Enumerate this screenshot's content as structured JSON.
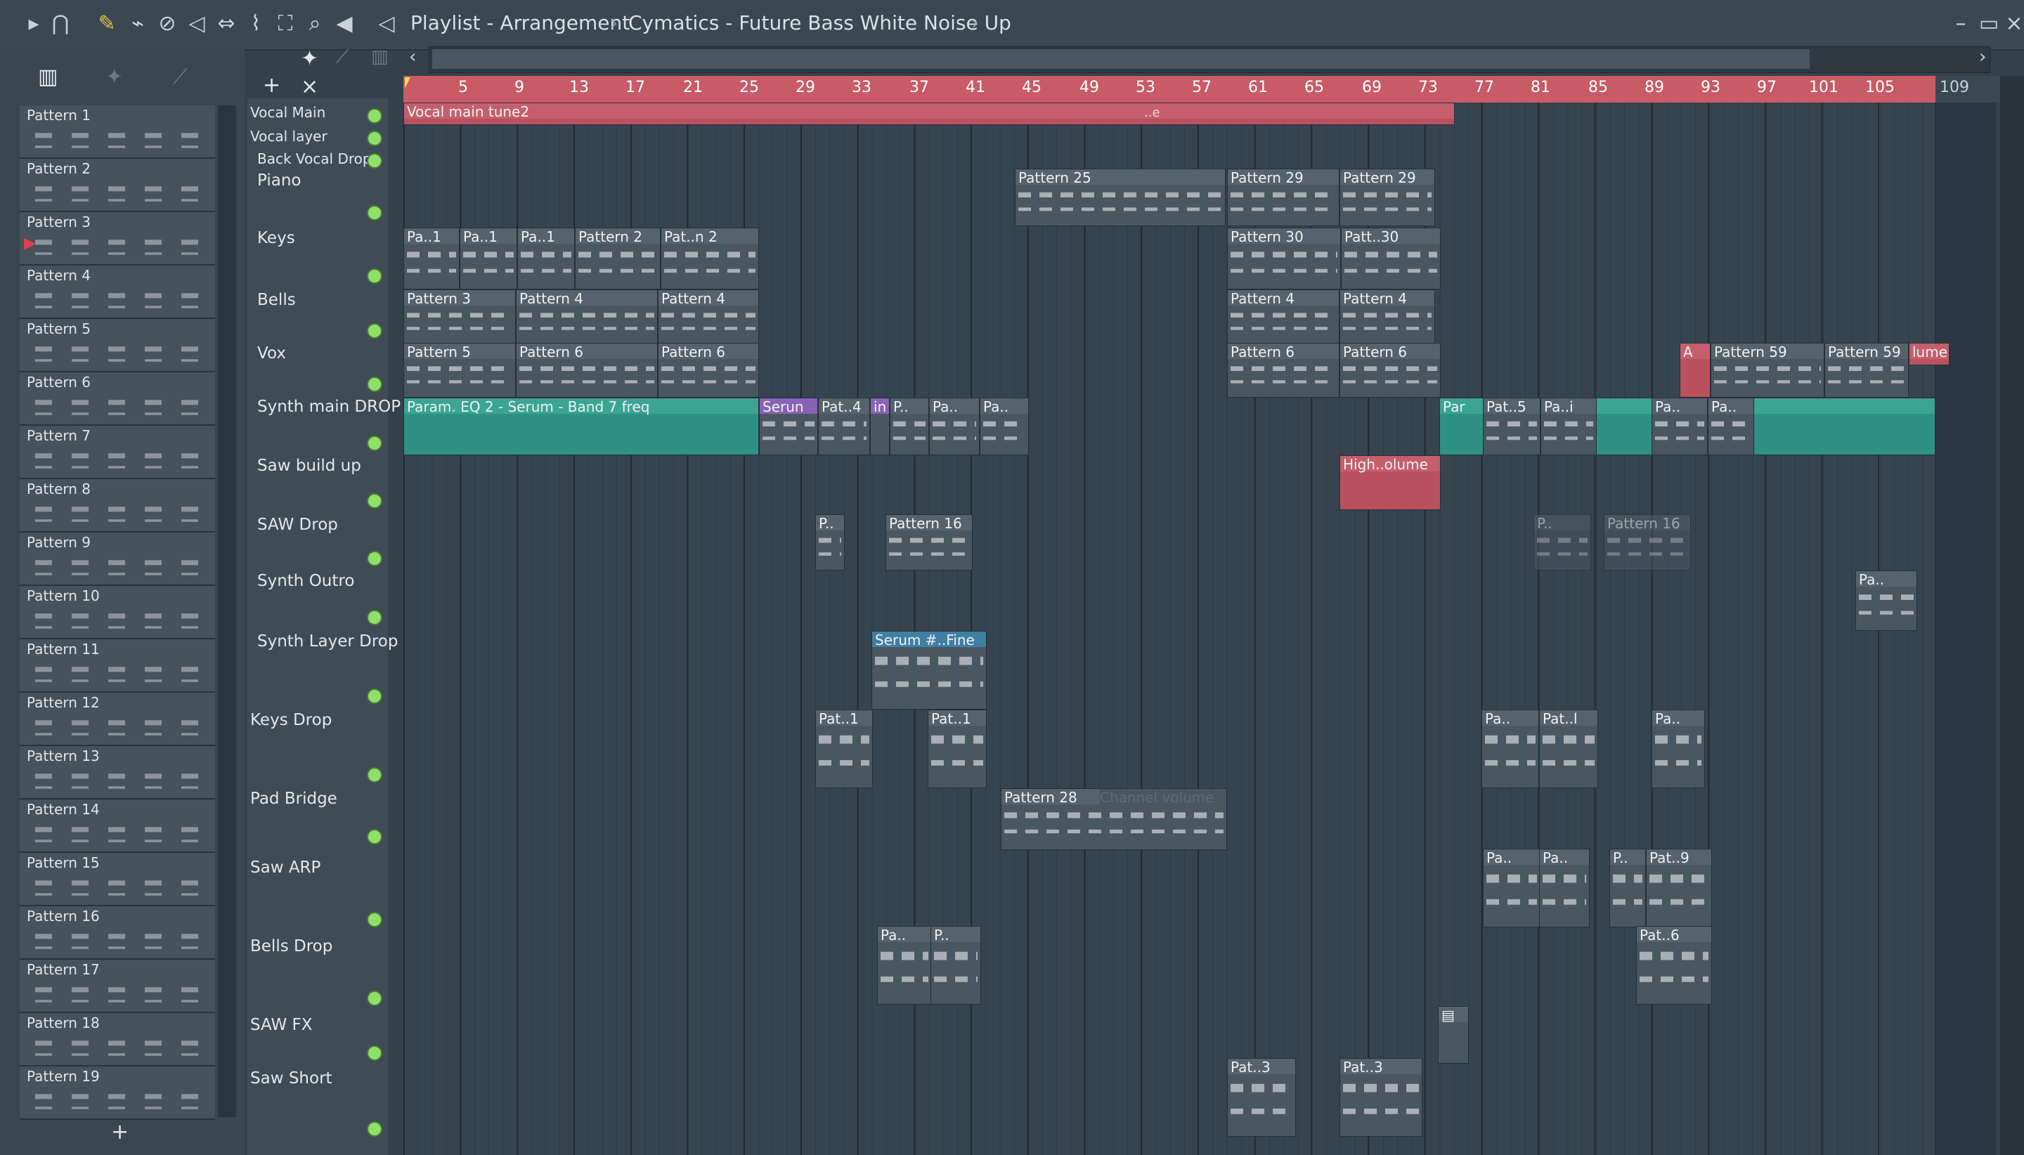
{
  "titlebar": {
    "title": "Playlist - Arrangement",
    "project": "Cymatics - Future Bass White Noise Up"
  },
  "patterns": [
    "Pattern 1",
    "Pattern 2",
    "Pattern 3",
    "Pattern 4",
    "Pattern 5",
    "Pattern 6",
    "Pattern 7",
    "Pattern 8",
    "Pattern 9",
    "Pattern 10",
    "Pattern 11",
    "Pattern 12",
    "Pattern 13",
    "Pattern 14",
    "Pattern 15",
    "Pattern 16",
    "Pattern 17",
    "Pattern 18",
    "Pattern 19"
  ],
  "ruler": [
    "5",
    "9",
    "13",
    "17",
    "21",
    "25",
    "29",
    "33",
    "37",
    "41",
    "45",
    "49",
    "53",
    "57",
    "61",
    "65",
    "69",
    "73",
    "77",
    "81",
    "85",
    "89",
    "93",
    "97",
    "101",
    "105",
    "109"
  ],
  "tracks": [
    "Vocal Main",
    "Vocal layer",
    "Back Vocal Drop",
    "Piano",
    "Keys",
    "Bells",
    "Vox",
    "Synth main DROP",
    "Saw build up",
    "SAW Drop",
    "Synth Outro",
    "Synth Layer Drop",
    "Keys Drop",
    "Pad Bridge",
    "Saw ARP",
    "Bells Drop",
    "SAW FX",
    "Saw Short"
  ],
  "clips": {
    "vocal_main": "Vocal main tune2",
    "vocal_main_b": "..e",
    "piano_1": "Pattern 25",
    "piano_2": "Pattern 29",
    "piano_3": "Pattern 29",
    "keys_1": "Pa..1",
    "keys_2": "Pa..1",
    "keys_3": "Pa..1",
    "keys_4": "Pattern 2",
    "keys_5": "Pat..n 2",
    "keys_6": "Pattern 30",
    "keys_7": "Patt..30",
    "bells_1": "Pattern 3",
    "bells_2": "Pattern 4",
    "bells_3": "Pattern 4",
    "bells_4": "Pattern 4",
    "bells_5": "Pattern 4",
    "vox_1": "Pattern 5",
    "vox_2": "Pattern 6",
    "vox_3": "Pattern 6",
    "vox_4": "Pattern 6",
    "vox_5": "Pattern 6",
    "vox_6": "A",
    "vox_7": "Pattern 59",
    "vox_8": "Pattern 59",
    "vox_9": "lume",
    "synth_1": "Param. EQ 2 - Serum - Band 7 freq",
    "synth_2": "Serun",
    "synth_3": "Pat..4",
    "synth_4": "in",
    "synth_5": "P..",
    "synth_6": "Pa..",
    "synth_7": "Pa..",
    "synth_8": "Par",
    "synth_9": "Pat..5",
    "synth_10": "Pa..i",
    "synth_11": "Pa..",
    "synth_12": "Pa..",
    "saw_build": "High..olume",
    "sawdrop_1": "P..",
    "sawdrop_2": "Pattern 16",
    "sawdrop_3": "P..",
    "sawdrop_4": "Pattern 16",
    "outro_1": "Pa..",
    "layer_1": "Serum #..Fine",
    "keysdrop_1": "Pat..1",
    "keysdrop_2": "Pat..1",
    "keysdrop_3": "Pa..",
    "keysdrop_4": "Pat..l",
    "keysdrop_5": "Pa..",
    "pad_1": "Pattern 28",
    "pad_2": "Channel volume",
    "arp_1": "Pa..",
    "arp_2": "Pa..",
    "arp_3": "P..",
    "arp_4": "Pat..9",
    "bellsdrop_1": "Pa..",
    "bellsdrop_2": "P..",
    "bellsdrop_3": "Pat..6",
    "short_1": "Pat..3",
    "short_2": "Pat..3"
  },
  "colors": {
    "ruler": "#c85b66",
    "automation_red": "#b9525e",
    "automation_teal": "#2e9183",
    "track_dot": "#8fe06a"
  },
  "icons": [
    "play-icon",
    "magnet-icon",
    "pencil-icon",
    "brush-icon",
    "delete-icon",
    "mute-icon",
    "slip-icon",
    "slice-icon",
    "select-icon",
    "zoom-icon",
    "speaker-icon"
  ]
}
